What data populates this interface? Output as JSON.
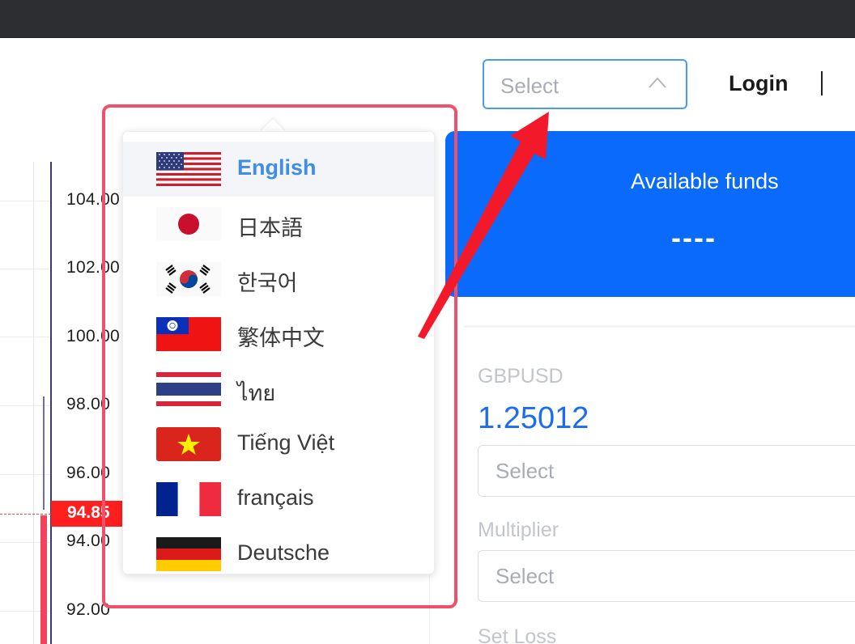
{
  "header": {
    "select_placeholder": "Select",
    "login_label": "Login"
  },
  "chart": {
    "ticks": [
      "104.00",
      "102.00",
      "100.00",
      "98.00",
      "96.00",
      "94.00",
      "92.00"
    ],
    "current_price_label": "94.85",
    "current_price_color": "#ff1f1f"
  },
  "funds": {
    "title": "Available funds",
    "value": "----",
    "color": "#0a6afc"
  },
  "trade": {
    "symbol": "GBPUSD",
    "price": "1.25012",
    "symbol_select_placeholder": "Select",
    "multiplier_label": "Multiplier",
    "multiplier_placeholder": "Select",
    "set_loss_label": "Set Loss"
  },
  "language_menu": {
    "options": [
      {
        "label": "English",
        "flag": "us-flag-icon",
        "selected": true
      },
      {
        "label": "日本語",
        "flag": "japan-flag-icon"
      },
      {
        "label": "한국어",
        "flag": "korea-flag-icon"
      },
      {
        "label": "繁体中文",
        "flag": "taiwan-flag-icon"
      },
      {
        "label": "ไทย",
        "flag": "thailand-flag-icon"
      },
      {
        "label": "Tiếng Việt",
        "flag": "vietnam-flag-icon"
      },
      {
        "label": "français",
        "flag": "france-flag-icon"
      },
      {
        "label": "Deutsche",
        "flag": "germany-flag-icon"
      }
    ],
    "highlight_color": "#f0506a",
    "selected_color": "#3f8de6"
  }
}
